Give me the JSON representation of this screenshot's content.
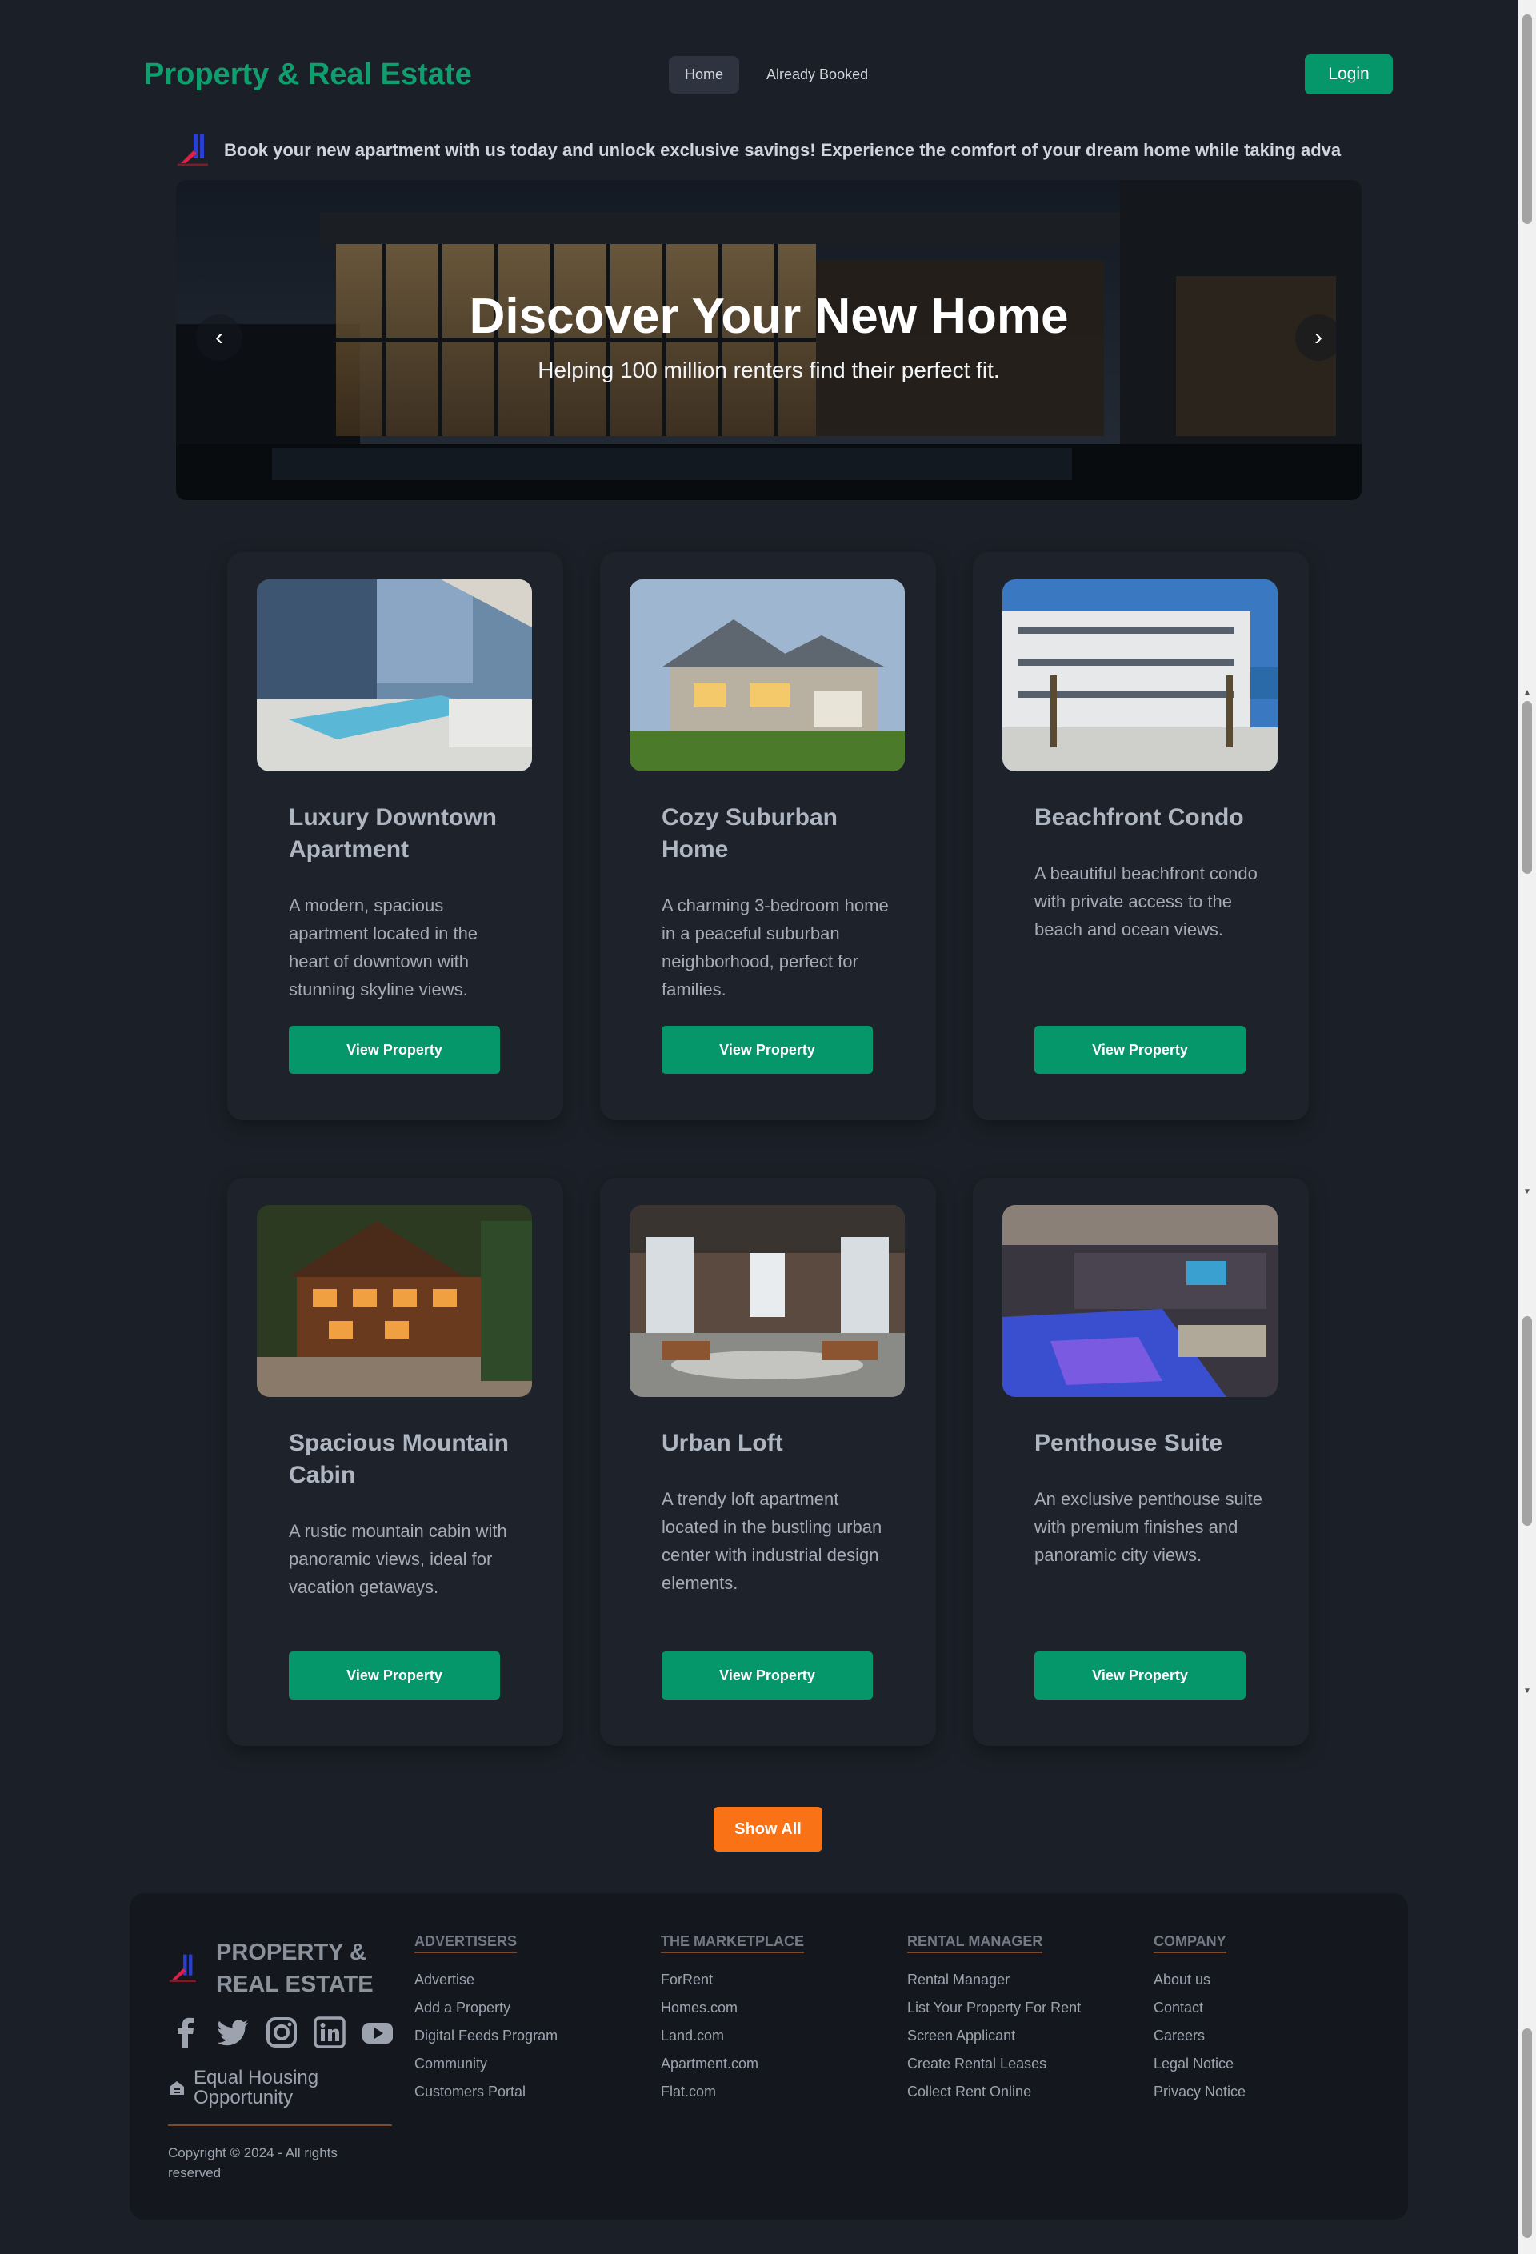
{
  "header": {
    "brand": "Property & Real Estate",
    "nav": [
      {
        "label": "Home"
      },
      {
        "label": "Already Booked"
      }
    ],
    "login_label": "Login"
  },
  "promo": {
    "text": "Book your new apartment with us today and unlock exclusive savings! Experience the comfort of your dream home while taking adva"
  },
  "hero": {
    "title": "Discover Your New Home",
    "subtitle": "Helping 100 million renters find their perfect fit.",
    "prev_icon": "‹",
    "next_icon": "›"
  },
  "properties": [
    {
      "title": "Luxury Downtown Apartment",
      "description": "A modern, spacious apartment located in the heart of downtown with stunning skyline views.",
      "button": "View Property"
    },
    {
      "title": "Cozy Suburban Home",
      "description": "A charming 3-bedroom home in a peaceful suburban neighborhood, perfect for families.",
      "button": "View Property"
    },
    {
      "title": "Beachfront Condo",
      "description": "A beautiful beachfront condo with private access to the beach and ocean views.",
      "button": "View Property"
    },
    {
      "title": "Spacious Mountain Cabin",
      "description": "A rustic mountain cabin with panoramic views, ideal for vacation getaways.",
      "button": "View Property"
    },
    {
      "title": "Urban Loft",
      "description": "A trendy loft apartment located in the bustling urban center with industrial design elements.",
      "button": "View Property"
    },
    {
      "title": "Penthouse Suite",
      "description": "An exclusive penthouse suite with premium finishes and panoramic city views.",
      "button": "View Property"
    }
  ],
  "show_all_label": "Show All",
  "footer": {
    "brand": "Property & Real Estate",
    "social_icons": [
      "facebook-icon",
      "twitter-icon",
      "instagram-icon",
      "linkedin-icon",
      "youtube-icon"
    ],
    "equal_housing": "Equal Housing Opportunity",
    "copyright": "Copyright © 2024 - All rights reserved",
    "columns": [
      {
        "heading": "Advertisers",
        "links": [
          "Advertise",
          "Add a Property",
          "Digital Feeds Program",
          "Community",
          "Customers Portal"
        ]
      },
      {
        "heading": "The Marketplace",
        "links": [
          "ForRent",
          "Homes.com",
          "Land.com",
          "Apartment.com",
          "Flat.com"
        ]
      },
      {
        "heading": "Rental Manager",
        "links": [
          "Rental Manager",
          "List Your Property For Rent",
          "Screen Applicant",
          "Create Rental Leases",
          "Collect Rent Online"
        ]
      },
      {
        "heading": "Company",
        "links": [
          "About us",
          "Contact",
          "Careers",
          "Legal Notice",
          "Privacy Notice"
        ]
      }
    ]
  },
  "colors": {
    "accent": "#059669",
    "brand_text": "#0f9f6e",
    "show_all": "#f97316",
    "background": "#1b2028",
    "footer_bg": "#14181e"
  }
}
